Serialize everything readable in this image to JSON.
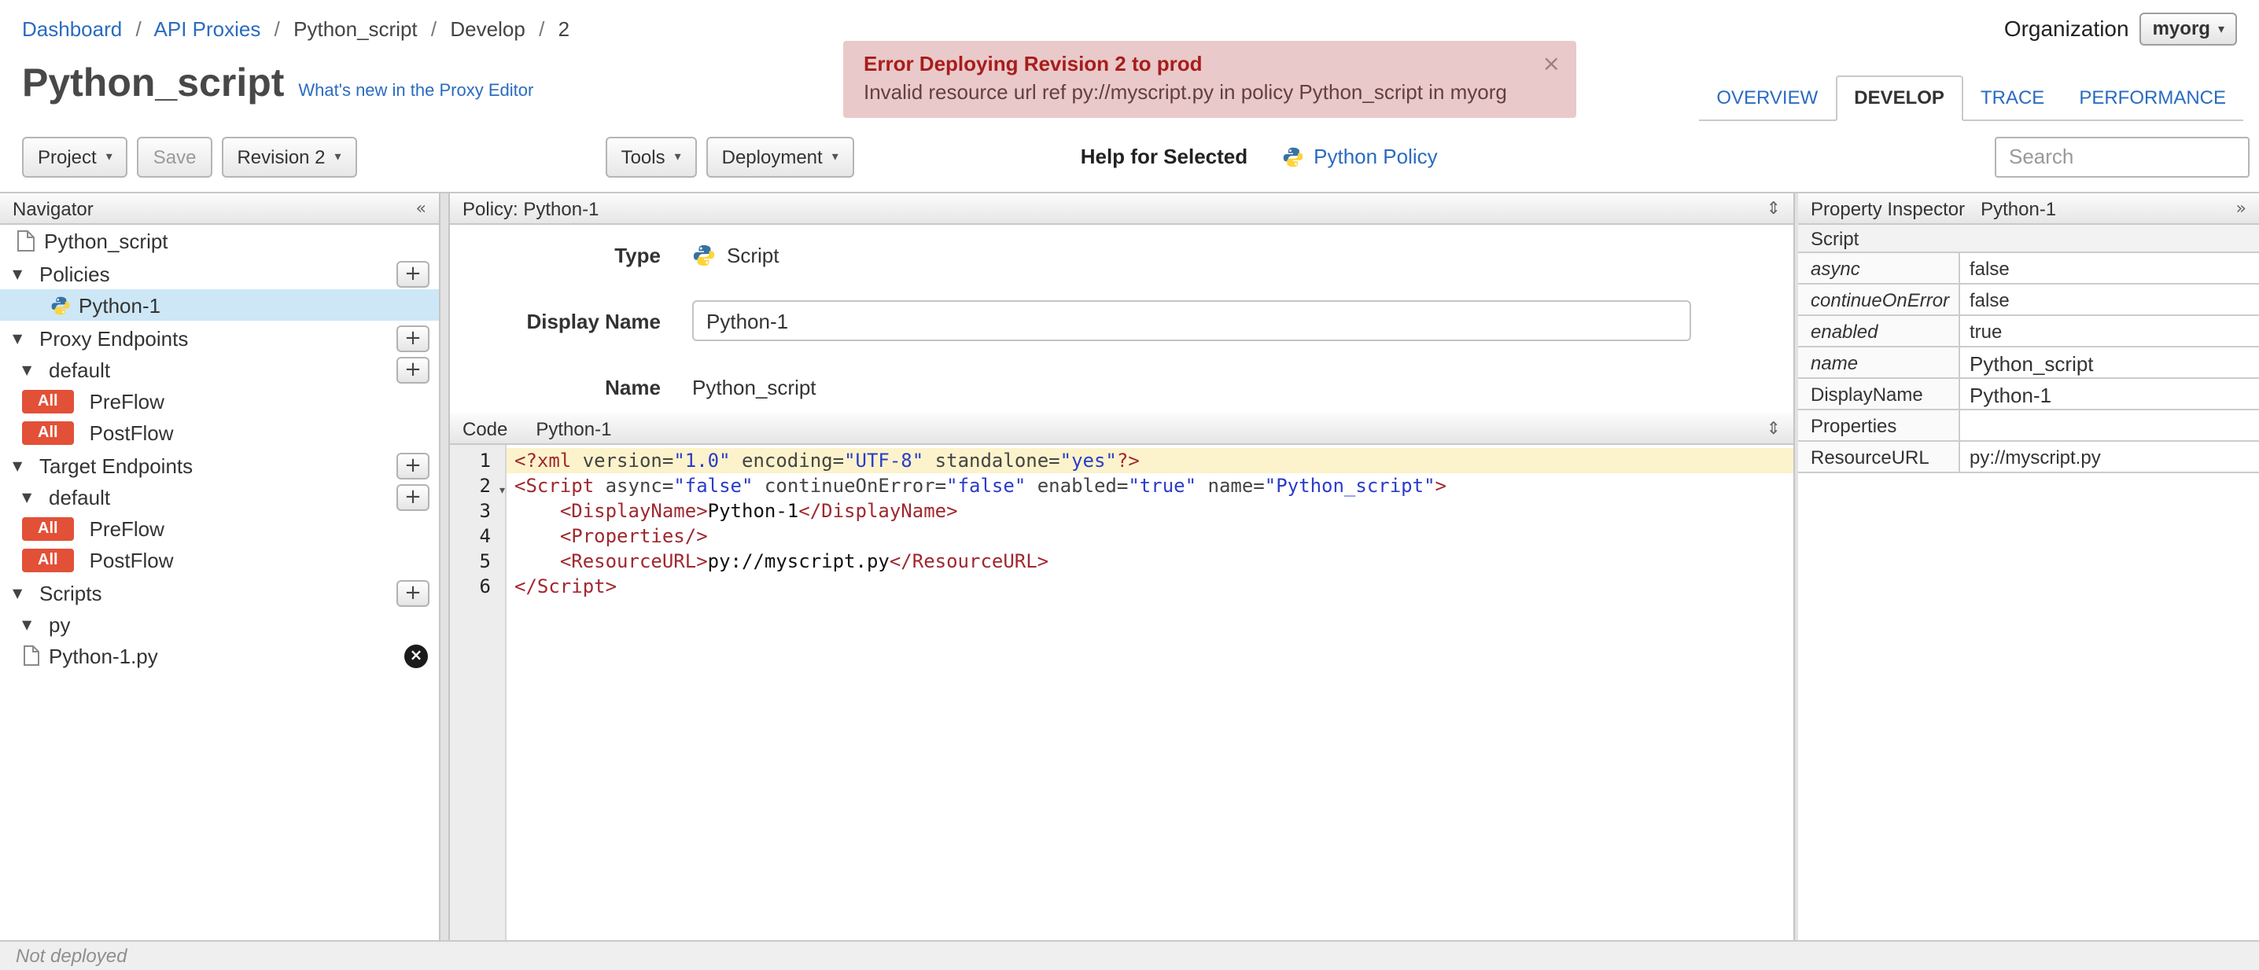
{
  "icons": {
    "caret_down": "▾",
    "tri_down": "▼",
    "plus": "+",
    "close_x": "×",
    "delete_x": "×",
    "collapse_left": "«",
    "expand_right": "»",
    "collapse_vertical": "⇕"
  },
  "breadcrumb": {
    "separator": "/",
    "items": [
      "Dashboard",
      "API Proxies",
      "Python_script",
      "Develop",
      "2"
    ]
  },
  "org": {
    "label": "Organization",
    "value": "myorg"
  },
  "banner": {
    "title": "Error Deploying Revision 2 to prod",
    "message": "Invalid resource url ref py://myscript.py in policy Python_script in myorg"
  },
  "page": {
    "title": "Python_script",
    "whats_new_link": "What's new in the Proxy Editor"
  },
  "tabs": {
    "overview": "OVERVIEW",
    "develop": "DEVELOP",
    "trace": "TRACE",
    "performance": "PERFORMANCE"
  },
  "toolbar": {
    "project": "Project",
    "save": "Save",
    "revision": "Revision 2",
    "tools": "Tools",
    "deployment": "Deployment",
    "help_for_selected": "Help for Selected",
    "policy_link": "Python Policy",
    "search_placeholder": "Search"
  },
  "navigator": {
    "title": "Navigator",
    "rows": [
      {
        "label": "Python_script"
      },
      {
        "label": "Policies"
      },
      {
        "label": "Python-1"
      },
      {
        "label": "Proxy Endpoints"
      },
      {
        "label": "default"
      },
      {
        "badge": "All",
        "label": "PreFlow"
      },
      {
        "badge": "All",
        "label": "PostFlow"
      },
      {
        "label": "Target Endpoints"
      },
      {
        "label": "default"
      },
      {
        "badge": "All",
        "label": "PreFlow"
      },
      {
        "badge": "All",
        "label": "PostFlow"
      },
      {
        "label": "Scripts"
      },
      {
        "label": "py"
      },
      {
        "label": "Python-1.py"
      }
    ]
  },
  "policy": {
    "header": "Policy: Python-1",
    "type_label": "Type",
    "type_value": "Script",
    "display_name_label": "Display Name",
    "display_name_value": "Python-1",
    "name_label": "Name",
    "name_value": "Python_script"
  },
  "code": {
    "panel_label": "Code",
    "file_label": "Python-1",
    "lines": [
      {
        "n": "1",
        "tokens": [
          {
            "c": "tag",
            "v": "<?xml"
          },
          {
            "c": "attr",
            "v": " version="
          },
          {
            "c": "str",
            "v": "\"1.0\""
          },
          {
            "c": "attr",
            "v": " encoding="
          },
          {
            "c": "str",
            "v": "\"UTF-8\""
          },
          {
            "c": "attr",
            "v": " standalone="
          },
          {
            "c": "str",
            "v": "\"yes\""
          },
          {
            "c": "tag",
            "v": "?>"
          }
        ]
      },
      {
        "n": "2",
        "tokens": [
          {
            "c": "tag",
            "v": "<Script"
          },
          {
            "c": "attr",
            "v": " async="
          },
          {
            "c": "str",
            "v": "\"false\""
          },
          {
            "c": "attr",
            "v": " continueOnError="
          },
          {
            "c": "str",
            "v": "\"false\""
          },
          {
            "c": "attr",
            "v": " enabled="
          },
          {
            "c": "str",
            "v": "\"true\""
          },
          {
            "c": "attr",
            "v": " name="
          },
          {
            "c": "str",
            "v": "\"Python_script\""
          },
          {
            "c": "tag",
            "v": ">"
          }
        ]
      },
      {
        "n": "3",
        "tokens": [
          {
            "c": "ws",
            "v": "    "
          },
          {
            "c": "tag",
            "v": "<DisplayName>"
          },
          {
            "c": "txt",
            "v": "Python-1"
          },
          {
            "c": "tag",
            "v": "</DisplayName>"
          }
        ]
      },
      {
        "n": "4",
        "tokens": [
          {
            "c": "ws",
            "v": "    "
          },
          {
            "c": "tag",
            "v": "<Properties/>"
          }
        ]
      },
      {
        "n": "5",
        "tokens": [
          {
            "c": "ws",
            "v": "    "
          },
          {
            "c": "tag",
            "v": "<ResourceURL>"
          },
          {
            "c": "txt",
            "v": "py://myscript.py"
          },
          {
            "c": "tag",
            "v": "</ResourceURL>"
          }
        ]
      },
      {
        "n": "6",
        "tokens": [
          {
            "c": "tag",
            "v": "</Script>"
          }
        ]
      }
    ]
  },
  "inspector": {
    "title": "Property Inspector",
    "subject": "Python-1",
    "section": "Script",
    "rows": [
      {
        "label": "async",
        "value": "false"
      },
      {
        "label": "continueOnError",
        "value": "false"
      },
      {
        "label": "enabled",
        "value": "true"
      },
      {
        "label": "name",
        "value": "Python_script"
      },
      {
        "label": "DisplayName",
        "value": "Python-1"
      },
      {
        "label": "Properties",
        "value": ""
      },
      {
        "label": "ResourceURL",
        "value": "py://myscript.py"
      }
    ]
  },
  "statusbar": {
    "text": "Not deployed"
  }
}
